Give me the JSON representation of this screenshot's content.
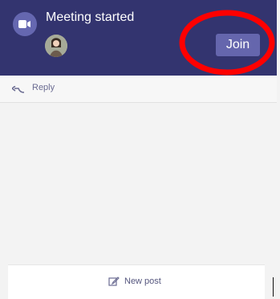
{
  "header": {
    "title": "Meeting started",
    "join_label": "Join",
    "icon": "video-camera-icon"
  },
  "reply": {
    "label": "Reply",
    "icon": "reply-arrow-icon"
  },
  "composer": {
    "label": "New post",
    "icon": "compose-icon"
  },
  "colors": {
    "header_bg": "#33346f",
    "join_button": "#6566ad",
    "annotation": "#ff0000"
  }
}
